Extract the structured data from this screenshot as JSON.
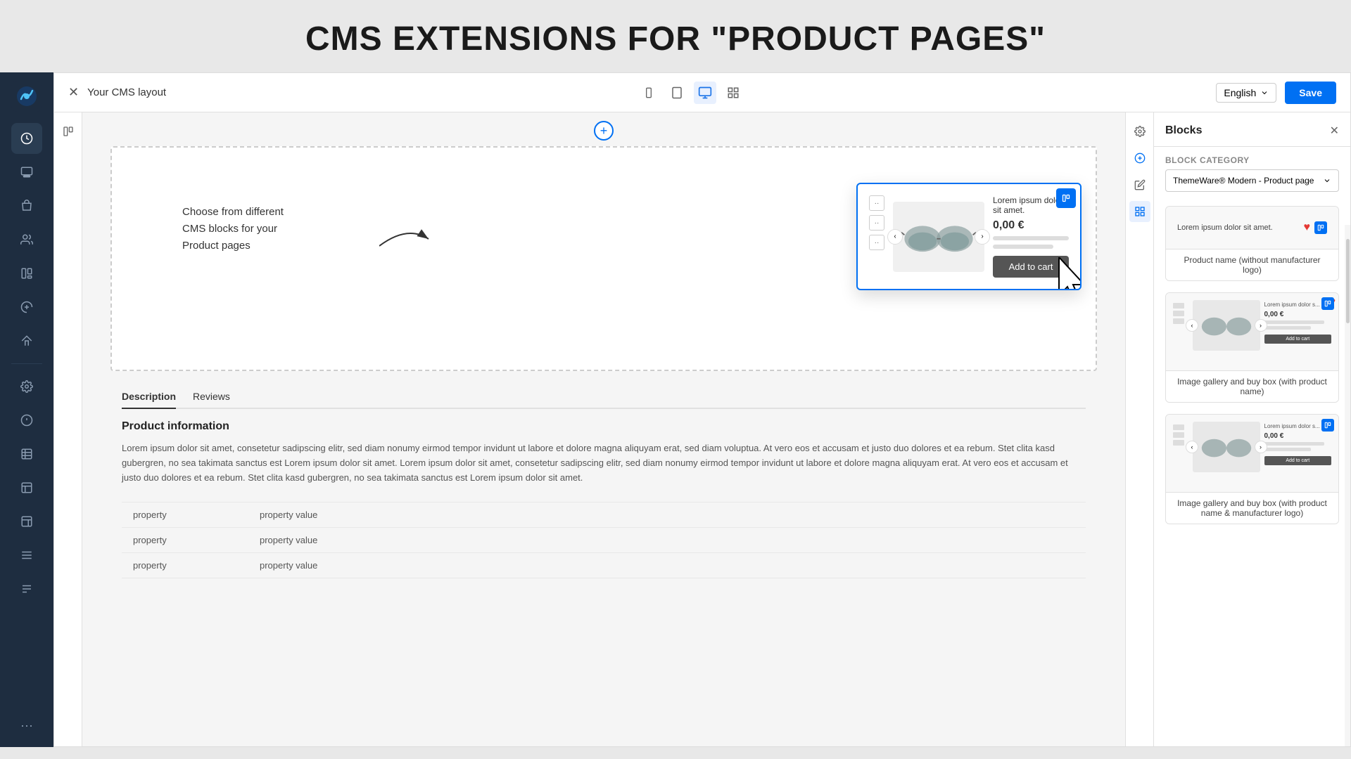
{
  "banner": {
    "title": "CMS EXTENSIONS FOR \"PRODUCT PAGES\""
  },
  "toolbar": {
    "layout_title": "Your CMS layout",
    "language": "English",
    "save_label": "Save",
    "views": [
      "mobile",
      "tablet",
      "desktop",
      "grid"
    ]
  },
  "annotation": {
    "text_line1": "Choose from different",
    "text_line2": "CMS blocks for your",
    "text_line3": "Product pages"
  },
  "product_card": {
    "name": "Lorem ipsum dolor sit amet.",
    "price": "0,00 €",
    "add_to_cart": "Add to cart"
  },
  "blocks_panel": {
    "title": "Blocks",
    "category_label": "Block category",
    "category_value": "ThemeWare® Modern - Product page",
    "items": [
      {
        "id": "block-1",
        "preview_text": "Lorem ipsum dolor sit amet.",
        "label": "Product name (without manufacturer logo)"
      },
      {
        "id": "block-2",
        "preview_price": "0,00 €",
        "preview_text": "Lorem ipsum dolor s...",
        "label": "Image gallery and buy box (with product name)"
      },
      {
        "id": "block-3",
        "preview_price": "0,00 €",
        "preview_text": "Lorem ipsum dolor s...",
        "label": "Image gallery and buy box (with product name & manufacturer logo)"
      }
    ]
  },
  "product_section": {
    "tabs": [
      "Description",
      "Reviews"
    ],
    "active_tab": "Description",
    "info_title": "Product information",
    "info_text": "Lorem ipsum dolor sit amet, consetetur sadipscing elitr, sed diam nonumy eirmod tempor invidunt ut labore et dolore magna aliquyam erat, sed diam voluptua. At vero eos et accusam et justo duo dolores et ea rebum. Stet clita kasd gubergren, no sea takimata sanctus est Lorem ipsum dolor sit amet. Lorem ipsum dolor sit amet, consetetur sadipscing elitr, sed diam nonumy eirmod tempor invidunt ut labore et dolore magna aliquyam erat. At vero eos et accusam et justo duo dolores et ea rebum. Stet clita kasd gubergren, no sea takimata sanctus est Lorem ipsum dolor sit amet.",
    "properties": [
      {
        "key": "property",
        "value": "property value"
      },
      {
        "key": "property",
        "value": "property value"
      },
      {
        "key": "property",
        "value": "property value"
      }
    ]
  },
  "sidebar": {
    "items": [
      {
        "id": "analytics",
        "icon": "chart"
      },
      {
        "id": "pages",
        "icon": "layers"
      },
      {
        "id": "products",
        "icon": "box"
      },
      {
        "id": "users",
        "icon": "users"
      },
      {
        "id": "layout",
        "icon": "layout"
      },
      {
        "id": "marketing",
        "icon": "megaphone"
      },
      {
        "id": "themes",
        "icon": "paintbrush"
      },
      {
        "id": "settings",
        "icon": "gear"
      },
      {
        "id": "info",
        "icon": "info"
      },
      {
        "id": "table1",
        "icon": "table"
      },
      {
        "id": "table2",
        "icon": "table2"
      },
      {
        "id": "table3",
        "icon": "table3"
      },
      {
        "id": "table4",
        "icon": "table4"
      },
      {
        "id": "table5",
        "icon": "table5"
      }
    ]
  }
}
